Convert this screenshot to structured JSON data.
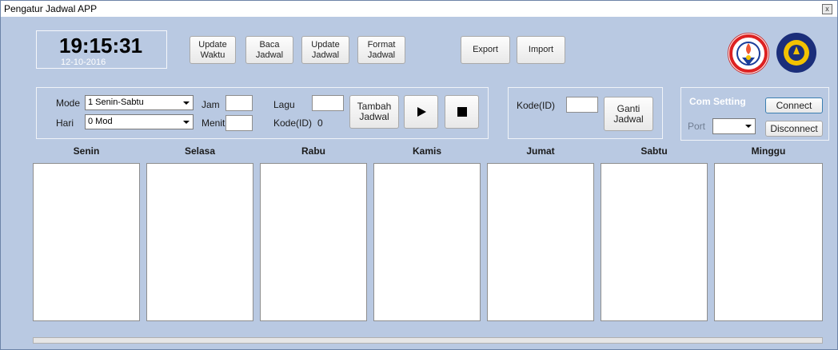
{
  "window": {
    "title": "Pengatur Jadwal APP",
    "close_symbol": "x"
  },
  "clock": {
    "time": "19:15:31",
    "date": "12-10-2016"
  },
  "toolbar": {
    "update_waktu": [
      "Update",
      "Waktu"
    ],
    "baca_jadwal": [
      "Baca",
      "Jadwal"
    ],
    "update_jadwal": [
      "Update",
      "Jadwal"
    ],
    "format_jadwal": [
      "Format",
      "Jadwal"
    ],
    "export": "Export",
    "import": "Import"
  },
  "schedule": {
    "mode_label": "Mode",
    "mode_value": "1 Senin-Sabtu",
    "hari_label": "Hari",
    "hari_value": "0 Mod",
    "jam_label": "Jam",
    "menit_label": "Menit",
    "lagu_label": "Lagu",
    "kode_label": "Kode(ID)",
    "kode_value": "0",
    "tambah_jadwal": [
      "Tambah",
      "Jadwal"
    ],
    "play_icon": "play-icon",
    "stop_icon": "stop-icon"
  },
  "ganti": {
    "kode_label": "Kode(ID)",
    "ganti_jadwal": [
      "Ganti",
      "Jadwal"
    ]
  },
  "com": {
    "title": "Com Setting",
    "port_label": "Port",
    "connect": "Connect",
    "disconnect": "Disconnect"
  },
  "days": [
    "Senin",
    "Selasa",
    "Rabu",
    "Kamis",
    "Jumat",
    "Sabtu",
    "Minggu"
  ],
  "colors": {
    "background": "#b9c9e2",
    "panel_border": "#f0f3f8"
  }
}
